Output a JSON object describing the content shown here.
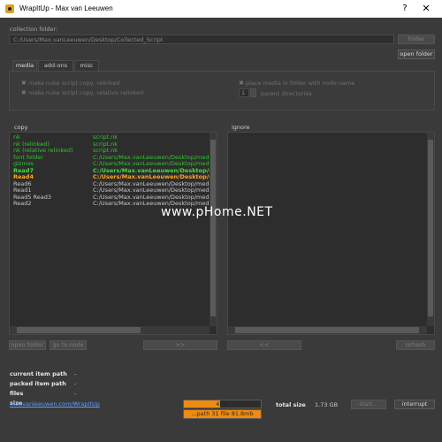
{
  "window": {
    "title": "WrapItUp - Max van Leeuwen",
    "help": "?",
    "close": "✕"
  },
  "collection": {
    "label": "collection folder:",
    "path": "C:/Users/Max.vanLeeuwen/Desktop/Collected_Script",
    "folder_btn": "folder",
    "open_folder_btn": "open folder"
  },
  "tabs": [
    {
      "label": "media"
    },
    {
      "label": "add-ons"
    },
    {
      "label": "misc"
    }
  ],
  "options": {
    "relinked": "make nuke script copy, relinked",
    "relative_relinked": "make nuke script copy, relative relinked",
    "place_media": "place media in folder with node name",
    "parent_count": "1",
    "parent_dirs": "parent directories"
  },
  "copy": {
    "label": "copy",
    "rows": [
      {
        "name": "nk",
        "path": "script.nk",
        "style": "green"
      },
      {
        "name": "nk (relinked)",
        "path": "script.nk",
        "style": "green"
      },
      {
        "name": "nk (relative relinked)",
        "path": "script.nk",
        "style": "green"
      },
      {
        "name": "font folder",
        "path": "C:/Users/Max.vanLeeuwen/Desktop/media",
        "style": "green"
      },
      {
        "name": "gizmos",
        "path": "C:/Users/Max.vanLeeuwen/Desktop/media",
        "style": "green"
      },
      {
        "name": "Read7",
        "path": "C:/Users/Max.vanLeeuwen/Desktop/media",
        "style": "bold-green"
      },
      {
        "name": "Read4",
        "path": "C:/Users/Max.vanLeeuwen/Desktop/media",
        "style": "orange"
      },
      {
        "name": "Read6",
        "path": "C:/Users/Max.vanLeeuwen/Desktop/media",
        "style": "plain"
      },
      {
        "name": "Read1",
        "path": "C:/Users/Max.vanLeeuwen/Desktop/media",
        "style": "plain"
      },
      {
        "name": "Read5 Read3",
        "path": "C:/Users/Max.vanLeeuwen/Desktop/media",
        "style": "plain"
      },
      {
        "name": "Read2",
        "path": "C:/Users/Max.vanLeeuwen/Desktop/media",
        "style": "plain"
      }
    ],
    "open_folder_btn": "open folder",
    "go_to_node_btn": "go to node",
    "move_right_btn": ">>"
  },
  "ignore": {
    "label": "ignore",
    "move_left_btn": "<<",
    "refresh_btn": "refresh"
  },
  "info": {
    "current_item_path_label": "current item path",
    "current_item_path_value": "-",
    "packed_item_path_label": "packed item path",
    "packed_item_path_value": "-",
    "files_label": "files",
    "files_value": "-",
    "size_label": "size",
    "size_value": "-"
  },
  "progress": {
    "top_text": "...path 31 file 81.8mb",
    "top_level": 1.0,
    "bottom_text": "47%",
    "bottom_level": 0.47,
    "total_size_label": "total size",
    "total_size_value": "1.73 GB",
    "start_btn": "start...",
    "interrupt_btn": "interrupt"
  },
  "footer": {
    "link": "maxvanleeuwen.com/WrapItUp"
  },
  "watermark": "www.pHome.NET",
  "colors": {
    "accent_orange": "#ef8a12",
    "ok_green": "#2ec82e",
    "warn_orange": "#ffa51f",
    "link_blue": "#55a0ff"
  }
}
